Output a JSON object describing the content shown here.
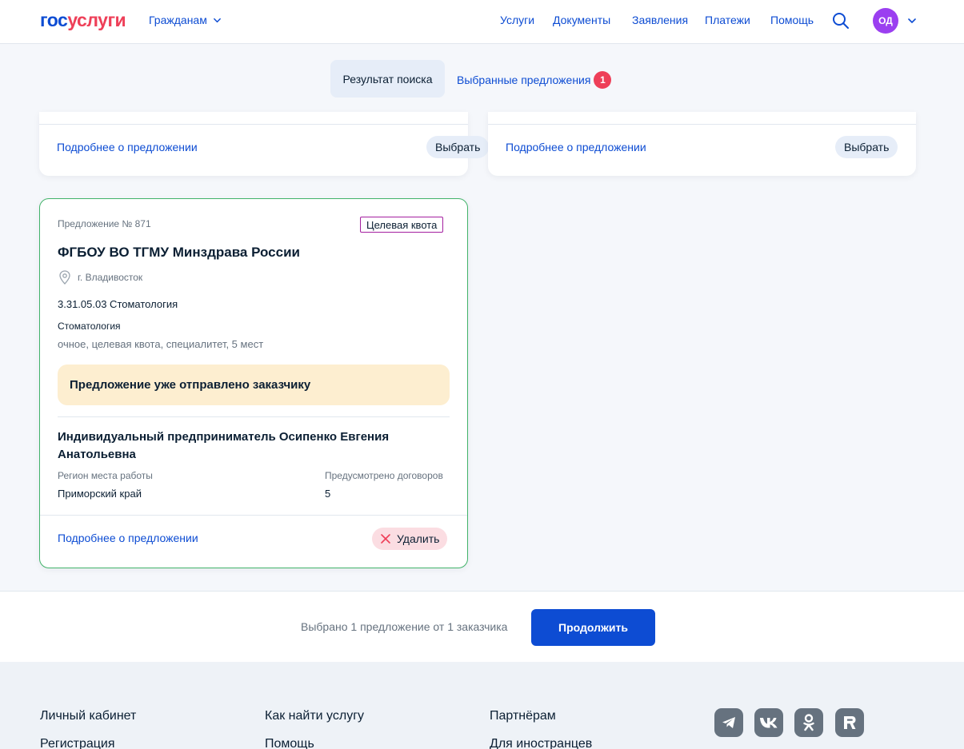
{
  "header": {
    "logo_part1": "гос",
    "logo_part2": "услуги",
    "audience": "Гражданам",
    "nav": [
      "Услуги",
      "Документы",
      "Заявления",
      "Платежи",
      "Помощь"
    ],
    "avatar_initials": "ОД"
  },
  "tabs": {
    "search_result": "Результат поиска",
    "favorites": "Выбранные предложения",
    "favorites_count": "1"
  },
  "partial_cards": [
    {
      "details_link": "Подробнее о предложении",
      "choose_label": "Выбрать"
    },
    {
      "details_link": "Подробнее о предложении",
      "choose_label": "Выбрать"
    }
  ],
  "offer": {
    "number": "Предложение № 871",
    "tag": "Целевая квота",
    "organization": "ФГБОУ ВО ТГМУ Минздрава России",
    "location": "г. Владивосток",
    "specialty_code": "3.31.05.03 Стоматология",
    "specialty_name": "Стоматология",
    "params": "очное, целевая квота, специалитет, 5 мест",
    "notice": "Предложение уже отправлено заказчику",
    "employer": "Индивидуальный предприниматель Осипенко Евгения Анатольевна",
    "region_label": "Регион места работы",
    "region_value": "Приморский край",
    "contracts_label": "Предусмотрено договоров",
    "contracts_value": "5",
    "details_link": "Подробнее о предложении",
    "delete_label": "Удалить"
  },
  "bottom_bar": {
    "selected_text": "Выбрано 1 предложение от 1 заказчика",
    "continue_label": "Продолжить"
  },
  "footer": {
    "col1": [
      "Личный кабинет",
      "Регистрация"
    ],
    "col2": [
      "Как найти услугу",
      "Помощь"
    ],
    "col3": [
      "Партнёрам",
      "Для иностранцев"
    ],
    "social_icons": [
      "telegram-icon",
      "vk-icon",
      "odnoklassniki-icon",
      "rutube-icon"
    ]
  },
  "colors": {
    "primary": "#0d4cd3",
    "accent_red": "#ee3f58",
    "card_border_selected": "#42b36a",
    "notice_bg": "#fdeed0",
    "avatar_bg": "#9b3ff0"
  }
}
